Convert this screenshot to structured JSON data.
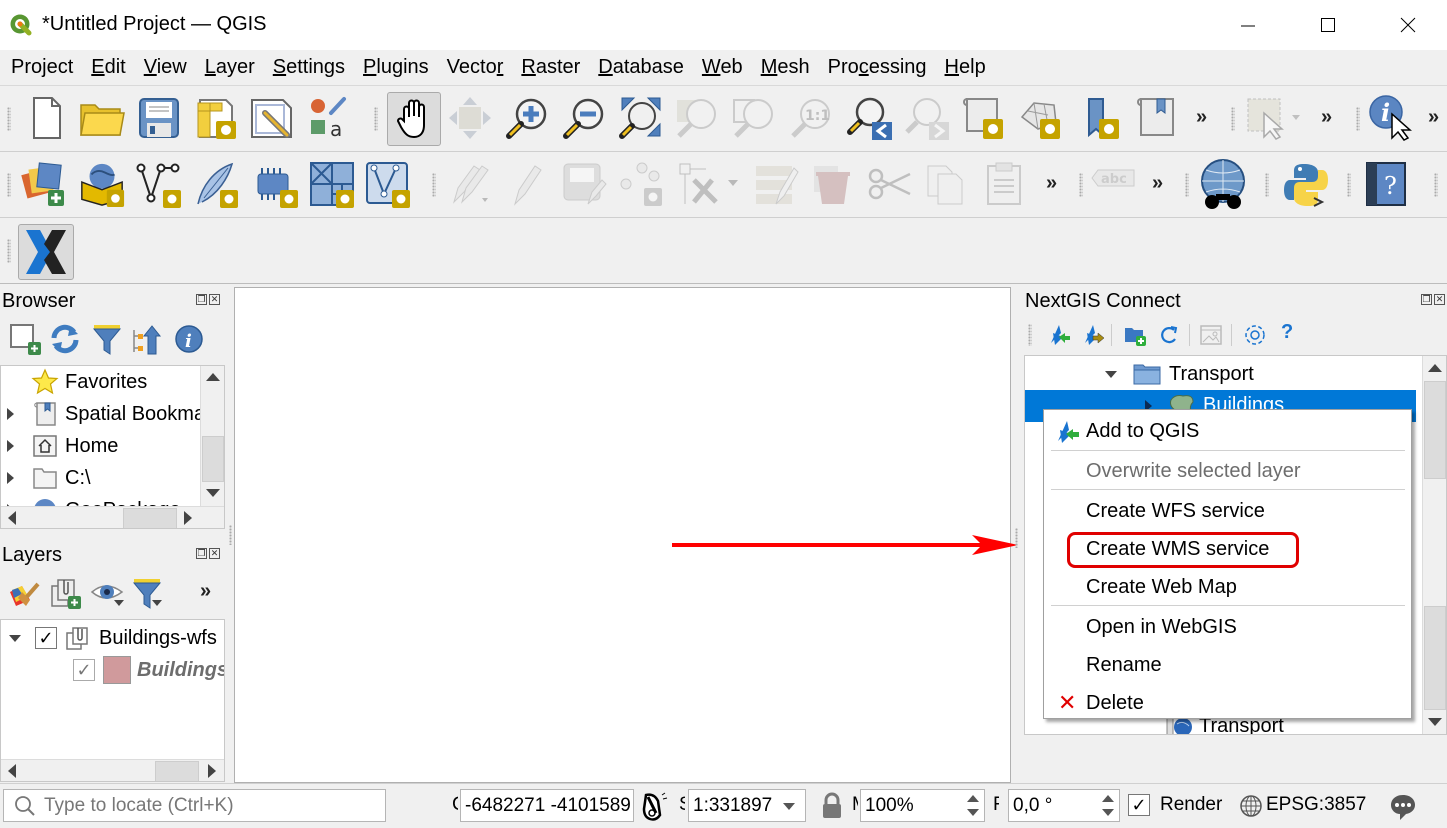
{
  "window": {
    "title": "*Untitled Project — QGIS",
    "controls": [
      "minimize",
      "maximize",
      "close"
    ]
  },
  "menubar": {
    "items": [
      {
        "label": "Project",
        "accel_index": 3
      },
      {
        "label": "Edit",
        "accel_index": 0
      },
      {
        "label": "View",
        "accel_index": 0
      },
      {
        "label": "Layer",
        "accel_index": 0
      },
      {
        "label": "Settings",
        "accel_index": 0
      },
      {
        "label": "Plugins",
        "accel_index": 0
      },
      {
        "label": "Vector",
        "accel_index": 5
      },
      {
        "label": "Raster",
        "accel_index": 0
      },
      {
        "label": "Database",
        "accel_index": 0
      },
      {
        "label": "Web",
        "accel_index": 0
      },
      {
        "label": "Mesh",
        "accel_index": 0
      },
      {
        "label": "Processing",
        "accel_index": 3
      },
      {
        "label": "Help",
        "accel_index": 0
      }
    ]
  },
  "toolbar1": {
    "icons": [
      "new-project",
      "open-project",
      "save-project",
      "new-print-layout",
      "layout-manager",
      "style-manager",
      "pan-map",
      "pan-to-selection",
      "zoom-in",
      "zoom-out",
      "zoom-full",
      "zoom-to-selection",
      "zoom-to-layer",
      "zoom-native",
      "zoom-last",
      "zoom-next",
      "new-spatial-bookmark",
      "new-3d-map",
      "new-bookmark",
      "show-bookmarks",
      "select-features",
      "identify-features"
    ],
    "overflow": "»"
  },
  "toolbar2": {
    "icons": [
      "data-source-manager",
      "new-geopackage",
      "new-shapefile",
      "new-spatialite",
      "new-virtual-layer",
      "new-temp-scratch",
      "new-mesh",
      "toggle-editing",
      "current-edits",
      "save-edits",
      "add-point",
      "vertex-tool",
      "modify-attributes",
      "delete-selected",
      "cut-features",
      "copy-features",
      "paste-features",
      "label-tool",
      "metasearch",
      "python-console",
      "help-contents"
    ],
    "overflow": "»"
  },
  "toolbar3": {
    "icons": [
      "nextgis-connect"
    ]
  },
  "browser": {
    "title": "Browser",
    "toolbar": [
      "add-selected-layers",
      "refresh",
      "filter",
      "collapse-all",
      "properties"
    ],
    "items": [
      {
        "label": "Favorites",
        "icon": "star",
        "expandable": false
      },
      {
        "label": "Spatial Bookmarks",
        "icon": "bookmark",
        "expandable": true
      },
      {
        "label": "Home",
        "icon": "home",
        "expandable": true
      },
      {
        "label": "C:\\",
        "icon": "folder",
        "expandable": true
      },
      {
        "label": "GeoPackage",
        "icon": "geopackage",
        "expandable": true
      }
    ]
  },
  "layers": {
    "title": "Layers",
    "toolbar": [
      "style-panel",
      "add-group",
      "manage-visibility",
      "filter-legend"
    ],
    "overflow": "»",
    "items": [
      {
        "label": "Buildings-wfs",
        "checked": true,
        "expanded": true,
        "type": "group"
      },
      {
        "label": "Buildings",
        "checked": true,
        "type": "layer",
        "swatch_color": "#d09a9c"
      }
    ]
  },
  "nextgis": {
    "title": "NextGIS Connect",
    "toolbar": [
      "add-to-qgis",
      "import-to-ngw",
      "create-group",
      "refresh",
      "create-web-map",
      "settings",
      "help"
    ],
    "tree": [
      {
        "label": "Transport",
        "icon": "folder",
        "expanded": true
      },
      {
        "label": "Buildings",
        "icon": "vector-layer",
        "selected": true
      },
      {
        "label": "Transport",
        "icon": "wms-service"
      }
    ]
  },
  "context_menu": {
    "items": [
      {
        "label": "Add to QGIS",
        "icon": "add-to-qgis",
        "enabled": true
      },
      {
        "label": "Overwrite selected layer",
        "enabled": false
      },
      {
        "label": "Create WFS service",
        "enabled": true
      },
      {
        "label": "Create WMS service",
        "enabled": true,
        "highlighted": true
      },
      {
        "label": "Create Web Map",
        "enabled": true
      },
      {
        "label": "Open in WebGIS",
        "enabled": true
      },
      {
        "label": "Rename",
        "enabled": true
      },
      {
        "label": "Delete",
        "icon": "delete",
        "enabled": true
      }
    ],
    "highlight_color": "#e00000"
  },
  "annotation": {
    "arrow_color": "#ff0000"
  },
  "statusbar": {
    "locator_placeholder": "Type to locate (Ctrl+K)",
    "coordinate_label": "Coordinate",
    "coordinate": "-6482271 -4101589",
    "scale_label": "Scale",
    "scale": "1:331897",
    "magnifier_label": "Magnifier",
    "magnifier": "100%",
    "rotation_label": "Rotation",
    "rotation": "0,0 °",
    "render_label": "Render",
    "render_checked": true,
    "crs": "EPSG:3857"
  },
  "colors": {
    "selection_blue": "#0078d7",
    "accent_blue": "#1e7bd6"
  }
}
